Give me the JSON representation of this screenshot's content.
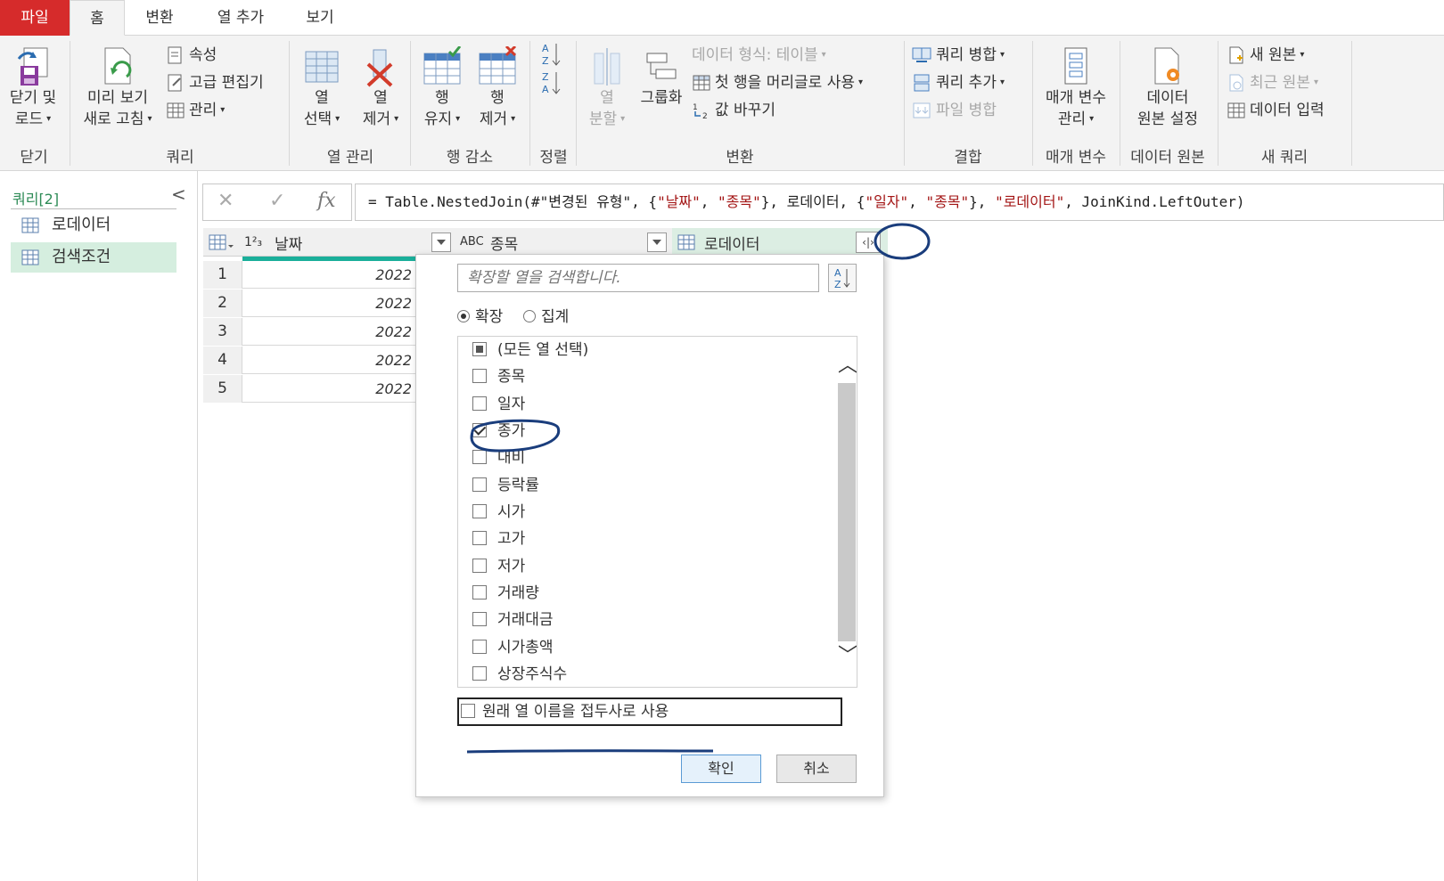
{
  "tabs": {
    "file": "파일",
    "home": "홈",
    "transform": "변환",
    "add_column": "열 추가",
    "view": "보기"
  },
  "ribbon": {
    "close_load": [
      "닫기 및",
      "로드"
    ],
    "close_group": "닫기",
    "refresh_preview": [
      "미리 보기",
      "새로 고침"
    ],
    "properties": "속성",
    "advanced_editor": "고급 편집기",
    "manage": "관리",
    "query_group": "쿼리",
    "choose_columns": [
      "열",
      "선택"
    ],
    "remove_columns": [
      "열",
      "제거"
    ],
    "manage_columns_group": "열 관리",
    "keep_rows": [
      "행",
      "유지"
    ],
    "remove_rows": [
      "행",
      "제거"
    ],
    "reduce_rows_group": "행 감소",
    "sort_group": "정렬",
    "split_column": [
      "열",
      "분할"
    ],
    "group_by": "그룹화",
    "data_type": "데이터 형식: 테이블",
    "use_first_row": "첫 행을 머리글로 사용",
    "replace_values": "값 바꾸기",
    "transform_group": "변환",
    "merge_queries": "쿼리 병합",
    "append_queries": "쿼리 추가",
    "combine_files": "파일 병합",
    "combine_group": "결합",
    "manage_parameters": [
      "매개 변수",
      "관리"
    ],
    "parameters_group": "매개 변수",
    "data_source_settings": [
      "데이터",
      "원본 설정"
    ],
    "data_sources_group": "데이터 원본",
    "new_source": "새 원본",
    "recent_sources": "최근 원본",
    "enter_data": "데이터 입력",
    "new_query_group": "새 쿼리"
  },
  "queries": {
    "header": "쿼리[2]",
    "items": [
      {
        "label": "로데이터"
      },
      {
        "label": "검색조건"
      }
    ]
  },
  "formula": {
    "fx": "fx",
    "parts": [
      "= Table.NestedJoin(#\"변경된 유형\", {",
      "\"날짜\"",
      ", ",
      "\"종목\"",
      "}, 로데이터, {",
      "\"일자\"",
      ", ",
      "\"종목\"",
      "}, ",
      "\"로데이터\"",
      ", JoinKind.LeftOuter)"
    ]
  },
  "grid": {
    "columns": [
      {
        "type": "1²₃",
        "name": "날짜"
      },
      {
        "type": "ABC",
        "name": "종목"
      },
      {
        "type": "table",
        "name": "로데이터"
      }
    ],
    "rows": [
      {
        "n": "1",
        "date": "2022"
      },
      {
        "n": "2",
        "date": "2022"
      },
      {
        "n": "3",
        "date": "2022"
      },
      {
        "n": "4",
        "date": "2022"
      },
      {
        "n": "5",
        "date": "2022"
      }
    ]
  },
  "expand_popup": {
    "search_placeholder": "확장할 열을 검색합니다.",
    "radio_expand": "확장",
    "radio_aggregate": "집계",
    "select_all": "(모든 열 선택)",
    "columns": [
      {
        "label": "종목",
        "checked": false
      },
      {
        "label": "일자",
        "checked": false
      },
      {
        "label": "종가",
        "checked": true
      },
      {
        "label": "대비",
        "checked": false
      },
      {
        "label": "등락률",
        "checked": false
      },
      {
        "label": "시가",
        "checked": false
      },
      {
        "label": "고가",
        "checked": false
      },
      {
        "label": "저가",
        "checked": false
      },
      {
        "label": "거래량",
        "checked": false
      },
      {
        "label": "거래대금",
        "checked": false
      },
      {
        "label": "시가총액",
        "checked": false
      },
      {
        "label": "상장주식수",
        "checked": false
      }
    ],
    "use_prefix": "원래 열 이름을 접두사로 사용",
    "ok": "확인",
    "cancel": "취소"
  },
  "colors": {
    "file_tab": "#d62b2b",
    "selected_query": "#d5eedf",
    "quality_bar": "#1aaf9a",
    "annotation": "#1a3d7c"
  }
}
